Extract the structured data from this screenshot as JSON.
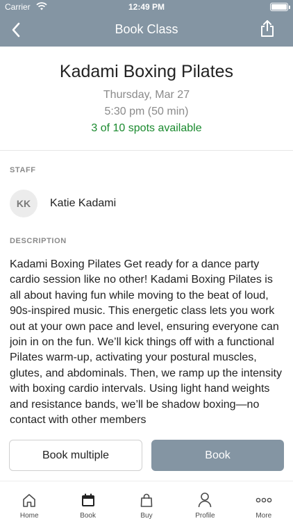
{
  "status_bar": {
    "carrier": "Carrier",
    "time": "12:49 PM"
  },
  "navbar": {
    "title": "Book Class"
  },
  "class": {
    "title": "Kadami Boxing Pilates",
    "date": "Thursday, Mar 27",
    "time": "5:30 pm (50 min)",
    "spots": "3 of 10 spots available"
  },
  "staff": {
    "section_label": "STAFF",
    "initials": "KK",
    "name": "Katie Kadami"
  },
  "description": {
    "section_label": "DESCRIPTION",
    "text": "Kadami Boxing Pilates Get ready for a dance party cardio session like no other! Kadami Boxing Pilates is all about having fun while moving to the beat of loud, 90s-inspired music. This energetic class lets you work out at your own pace and level, ensuring everyone can join in on the fun. We’ll kick things off with a functional Pilates warm-up, activating your postural muscles, glutes, and abdominals. Then, we ramp up the intensity with boxing cardio intervals. Using light hand weights and resistance bands, we’ll be shadow boxing—no contact with other members"
  },
  "actions": {
    "book_multiple": "Book multiple",
    "book": "Book"
  },
  "tabs": [
    {
      "label": "Home",
      "icon": "home-icon"
    },
    {
      "label": "Book",
      "icon": "calendar-icon"
    },
    {
      "label": "Buy",
      "icon": "bag-icon"
    },
    {
      "label": "Profile",
      "icon": "person-icon"
    },
    {
      "label": "More",
      "icon": "more-dots-icon"
    }
  ],
  "colors": {
    "header": "#8495a3",
    "spots": "#1a8a2e",
    "primary_button": "#8495a3"
  }
}
